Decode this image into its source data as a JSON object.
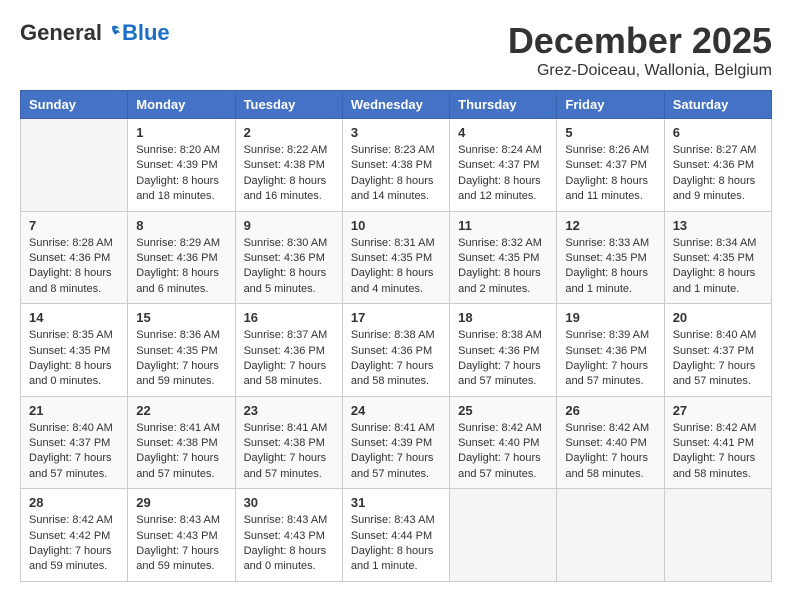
{
  "logo": {
    "general": "General",
    "blue": "Blue"
  },
  "title": "December 2025",
  "location": "Grez-Doiceau, Wallonia, Belgium",
  "weekdays": [
    "Sunday",
    "Monday",
    "Tuesday",
    "Wednesday",
    "Thursday",
    "Friday",
    "Saturday"
  ],
  "weeks": [
    [
      {
        "day": "",
        "info": ""
      },
      {
        "day": "1",
        "info": "Sunrise: 8:20 AM\nSunset: 4:39 PM\nDaylight: 8 hours\nand 18 minutes."
      },
      {
        "day": "2",
        "info": "Sunrise: 8:22 AM\nSunset: 4:38 PM\nDaylight: 8 hours\nand 16 minutes."
      },
      {
        "day": "3",
        "info": "Sunrise: 8:23 AM\nSunset: 4:38 PM\nDaylight: 8 hours\nand 14 minutes."
      },
      {
        "day": "4",
        "info": "Sunrise: 8:24 AM\nSunset: 4:37 PM\nDaylight: 8 hours\nand 12 minutes."
      },
      {
        "day": "5",
        "info": "Sunrise: 8:26 AM\nSunset: 4:37 PM\nDaylight: 8 hours\nand 11 minutes."
      },
      {
        "day": "6",
        "info": "Sunrise: 8:27 AM\nSunset: 4:36 PM\nDaylight: 8 hours\nand 9 minutes."
      }
    ],
    [
      {
        "day": "7",
        "info": "Sunrise: 8:28 AM\nSunset: 4:36 PM\nDaylight: 8 hours\nand 8 minutes."
      },
      {
        "day": "8",
        "info": "Sunrise: 8:29 AM\nSunset: 4:36 PM\nDaylight: 8 hours\nand 6 minutes."
      },
      {
        "day": "9",
        "info": "Sunrise: 8:30 AM\nSunset: 4:36 PM\nDaylight: 8 hours\nand 5 minutes."
      },
      {
        "day": "10",
        "info": "Sunrise: 8:31 AM\nSunset: 4:35 PM\nDaylight: 8 hours\nand 4 minutes."
      },
      {
        "day": "11",
        "info": "Sunrise: 8:32 AM\nSunset: 4:35 PM\nDaylight: 8 hours\nand 2 minutes."
      },
      {
        "day": "12",
        "info": "Sunrise: 8:33 AM\nSunset: 4:35 PM\nDaylight: 8 hours\nand 1 minute."
      },
      {
        "day": "13",
        "info": "Sunrise: 8:34 AM\nSunset: 4:35 PM\nDaylight: 8 hours\nand 1 minute."
      }
    ],
    [
      {
        "day": "14",
        "info": "Sunrise: 8:35 AM\nSunset: 4:35 PM\nDaylight: 8 hours\nand 0 minutes."
      },
      {
        "day": "15",
        "info": "Sunrise: 8:36 AM\nSunset: 4:35 PM\nDaylight: 7 hours\nand 59 minutes."
      },
      {
        "day": "16",
        "info": "Sunrise: 8:37 AM\nSunset: 4:36 PM\nDaylight: 7 hours\nand 58 minutes."
      },
      {
        "day": "17",
        "info": "Sunrise: 8:38 AM\nSunset: 4:36 PM\nDaylight: 7 hours\nand 58 minutes."
      },
      {
        "day": "18",
        "info": "Sunrise: 8:38 AM\nSunset: 4:36 PM\nDaylight: 7 hours\nand 57 minutes."
      },
      {
        "day": "19",
        "info": "Sunrise: 8:39 AM\nSunset: 4:36 PM\nDaylight: 7 hours\nand 57 minutes."
      },
      {
        "day": "20",
        "info": "Sunrise: 8:40 AM\nSunset: 4:37 PM\nDaylight: 7 hours\nand 57 minutes."
      }
    ],
    [
      {
        "day": "21",
        "info": "Sunrise: 8:40 AM\nSunset: 4:37 PM\nDaylight: 7 hours\nand 57 minutes."
      },
      {
        "day": "22",
        "info": "Sunrise: 8:41 AM\nSunset: 4:38 PM\nDaylight: 7 hours\nand 57 minutes."
      },
      {
        "day": "23",
        "info": "Sunrise: 8:41 AM\nSunset: 4:38 PM\nDaylight: 7 hours\nand 57 minutes."
      },
      {
        "day": "24",
        "info": "Sunrise: 8:41 AM\nSunset: 4:39 PM\nDaylight: 7 hours\nand 57 minutes."
      },
      {
        "day": "25",
        "info": "Sunrise: 8:42 AM\nSunset: 4:40 PM\nDaylight: 7 hours\nand 57 minutes."
      },
      {
        "day": "26",
        "info": "Sunrise: 8:42 AM\nSunset: 4:40 PM\nDaylight: 7 hours\nand 58 minutes."
      },
      {
        "day": "27",
        "info": "Sunrise: 8:42 AM\nSunset: 4:41 PM\nDaylight: 7 hours\nand 58 minutes."
      }
    ],
    [
      {
        "day": "28",
        "info": "Sunrise: 8:42 AM\nSunset: 4:42 PM\nDaylight: 7 hours\nand 59 minutes."
      },
      {
        "day": "29",
        "info": "Sunrise: 8:43 AM\nSunset: 4:43 PM\nDaylight: 7 hours\nand 59 minutes."
      },
      {
        "day": "30",
        "info": "Sunrise: 8:43 AM\nSunset: 4:43 PM\nDaylight: 8 hours\nand 0 minutes."
      },
      {
        "day": "31",
        "info": "Sunrise: 8:43 AM\nSunset: 4:44 PM\nDaylight: 8 hours\nand 1 minute."
      },
      {
        "day": "",
        "info": ""
      },
      {
        "day": "",
        "info": ""
      },
      {
        "day": "",
        "info": ""
      }
    ]
  ]
}
